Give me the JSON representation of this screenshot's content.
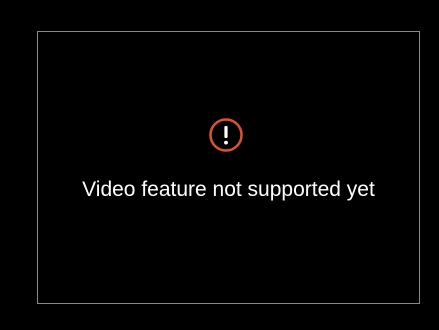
{
  "player": {
    "message": "Video feature not supported yet",
    "icon": "warning-icon",
    "icon_color": "#e0522d",
    "frame_color": "#8a8a8a",
    "background": "#000000"
  }
}
